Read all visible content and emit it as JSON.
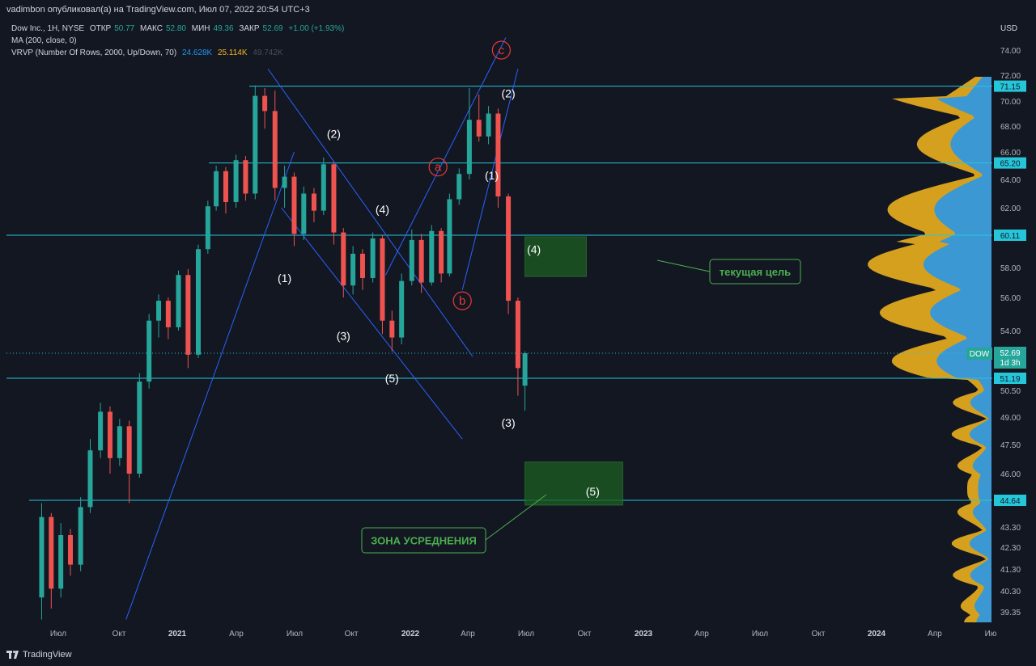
{
  "header": {
    "publisher": "vadimbon опубликовал(а) на TradingView.com, Июл 07, 2022 20:54 UTC+3"
  },
  "legend": {
    "symbol": "Dow Inc., 1H, NYSE",
    "open_label": "ОТКР",
    "open": "50.77",
    "high_label": "МАКС",
    "high": "52.80",
    "low_label": "МИН",
    "low": "49.36",
    "close_label": "ЗАКР",
    "close": "52.69",
    "change": "+1.00 (+1.93%)",
    "ma": "MA (200, close, 0)",
    "vrvp": "VRVP (Number Of Rows, 2000, Up/Down, 70)",
    "vrvp_up": "24.628K",
    "vrvp_down": "25.114K",
    "vrvp_total": "49.742K"
  },
  "footer": {
    "brand": "TradingView"
  },
  "colors": {
    "background": "#131722",
    "up": "#26a69a",
    "down": "#ef5350",
    "hline": "#26c6da",
    "channel": "#2962ff",
    "zone": "#1b5e20",
    "vp_up": "#2196f3",
    "vp_down": "#f9b81e",
    "label_red": "#e53935",
    "label_green": "#4caf50"
  },
  "chart_data": {
    "type": "candlestick",
    "symbol": "DOW",
    "currency": "USD",
    "x_ticks": [
      "Июл",
      "Окт",
      "2021",
      "Апр",
      "Июл",
      "Окт",
      "2022",
      "Апр",
      "Июл",
      "Окт",
      "2023",
      "Апр",
      "Июл",
      "Окт",
      "2024",
      "Апр",
      "Ию"
    ],
    "y_ticks": [
      "74.00",
      "72.00",
      "70.00",
      "68.00",
      "66.00",
      "64.00",
      "62.00",
      "58.00",
      "56.00",
      "54.00",
      "50.50",
      "49.00",
      "47.50",
      "46.00",
      "43.30",
      "42.30",
      "41.30",
      "40.30",
      "39.35"
    ],
    "horizontal_levels": [
      {
        "value": 71.15,
        "label": "71.15"
      },
      {
        "value": 65.2,
        "label": "65.20"
      },
      {
        "value": 60.11,
        "label": "60.11"
      },
      {
        "value": 51.19,
        "label": "51.19"
      },
      {
        "value": 44.64,
        "label": "44.64"
      }
    ],
    "current_price": {
      "symbol": "DOW",
      "price": "52.69",
      "countdown": "1d 3h"
    },
    "wave_labels": [
      {
        "text": "(1)",
        "date": "2021-06-20",
        "price": 57.3
      },
      {
        "text": "(2)",
        "date": "2021-09-05",
        "price": 67.4
      },
      {
        "text": "(3)",
        "date": "2021-09-20",
        "price": 53.7
      },
      {
        "text": "(4)",
        "date": "2021-11-20",
        "price": 61.9
      },
      {
        "text": "(5)",
        "date": "2021-12-05",
        "price": 51.2
      },
      {
        "text": "a",
        "date": "2022-02-15",
        "price": 64.9,
        "circled": true
      },
      {
        "text": "b",
        "date": "2022-03-25",
        "price": 55.8,
        "circled": true
      },
      {
        "text": "c",
        "date": "2022-05-25",
        "price": 74.0,
        "circled": true
      },
      {
        "text": "(1)",
        "date": "2022-05-10",
        "price": 64.3
      },
      {
        "text": "(2)",
        "date": "2022-06-05",
        "price": 70.6
      },
      {
        "text": "(3)",
        "date": "2022-06-05",
        "price": 48.7
      },
      {
        "text": "(4)",
        "date": "2022-07-15",
        "price": 59.2
      },
      {
        "text": "(5)",
        "date": "2022-10-15",
        "price": 45.1
      }
    ],
    "zones": [
      {
        "start": "2022-07-01",
        "end": "2022-10-05",
        "top": 60.0,
        "bottom": 57.4
      },
      {
        "start": "2022-07-01",
        "end": "2022-12-01",
        "top": 46.6,
        "bottom": 44.4
      }
    ],
    "callouts": [
      {
        "text": "текущая цель"
      },
      {
        "text": "ЗОНА УСРЕДНЕНИЯ"
      }
    ],
    "candles": [
      {
        "date": "2020-06-05",
        "o": 40.0,
        "h": 44.5,
        "l": 39.0,
        "c": 43.8
      },
      {
        "date": "2020-06-20",
        "o": 43.8,
        "h": 44.0,
        "l": 39.5,
        "c": 40.4
      },
      {
        "date": "2020-07-05",
        "o": 40.4,
        "h": 43.5,
        "l": 40.0,
        "c": 42.9
      },
      {
        "date": "2020-07-20",
        "o": 42.9,
        "h": 43.2,
        "l": 41.0,
        "c": 41.5
      },
      {
        "date": "2020-08-05",
        "o": 41.5,
        "h": 44.8,
        "l": 41.2,
        "c": 44.3
      },
      {
        "date": "2020-08-20",
        "o": 44.3,
        "h": 47.8,
        "l": 44.0,
        "c": 47.2
      },
      {
        "date": "2020-09-05",
        "o": 47.2,
        "h": 49.8,
        "l": 46.8,
        "c": 49.3
      },
      {
        "date": "2020-09-20",
        "o": 49.3,
        "h": 49.6,
        "l": 46.0,
        "c": 46.8
      },
      {
        "date": "2020-10-05",
        "o": 46.8,
        "h": 48.9,
        "l": 46.4,
        "c": 48.5
      },
      {
        "date": "2020-10-20",
        "o": 48.5,
        "h": 48.8,
        "l": 44.5,
        "c": 46.0
      },
      {
        "date": "2020-11-05",
        "o": 46.0,
        "h": 51.5,
        "l": 45.8,
        "c": 51.0
      },
      {
        "date": "2020-11-20",
        "o": 51.0,
        "h": 55.0,
        "l": 50.6,
        "c": 54.6
      },
      {
        "date": "2020-12-05",
        "o": 54.6,
        "h": 56.2,
        "l": 53.6,
        "c": 55.8
      },
      {
        "date": "2020-12-20",
        "o": 55.8,
        "h": 56.0,
        "l": 53.5,
        "c": 54.2
      },
      {
        "date": "2021-01-05",
        "o": 54.2,
        "h": 57.8,
        "l": 54.0,
        "c": 57.5
      },
      {
        "date": "2021-01-20",
        "o": 57.5,
        "h": 57.9,
        "l": 51.8,
        "c": 52.6
      },
      {
        "date": "2021-02-05",
        "o": 52.6,
        "h": 59.5,
        "l": 52.4,
        "c": 59.2
      },
      {
        "date": "2021-02-20",
        "o": 59.2,
        "h": 62.5,
        "l": 58.9,
        "c": 62.1
      },
      {
        "date": "2021-03-05",
        "o": 62.1,
        "h": 65.0,
        "l": 61.8,
        "c": 64.6
      },
      {
        "date": "2021-03-20",
        "o": 64.6,
        "h": 64.9,
        "l": 61.6,
        "c": 62.4
      },
      {
        "date": "2021-04-05",
        "o": 62.4,
        "h": 65.8,
        "l": 62.0,
        "c": 65.4
      },
      {
        "date": "2021-04-20",
        "o": 65.4,
        "h": 65.7,
        "l": 62.5,
        "c": 63.0
      },
      {
        "date": "2021-05-05",
        "o": 63.0,
        "h": 71.2,
        "l": 62.6,
        "c": 70.4
      },
      {
        "date": "2021-05-20",
        "o": 70.4,
        "h": 71.0,
        "l": 67.8,
        "c": 69.2
      },
      {
        "date": "2021-06-05",
        "o": 69.2,
        "h": 70.8,
        "l": 62.5,
        "c": 63.4
      },
      {
        "date": "2021-06-20",
        "o": 63.4,
        "h": 65.0,
        "l": 62.0,
        "c": 64.2
      },
      {
        "date": "2021-07-05",
        "o": 64.2,
        "h": 64.5,
        "l": 59.4,
        "c": 60.2
      },
      {
        "date": "2021-07-20",
        "o": 60.2,
        "h": 63.5,
        "l": 59.8,
        "c": 63.0
      },
      {
        "date": "2021-08-05",
        "o": 63.0,
        "h": 63.4,
        "l": 61.0,
        "c": 61.8
      },
      {
        "date": "2021-08-20",
        "o": 61.8,
        "h": 65.6,
        "l": 61.5,
        "c": 65.1
      },
      {
        "date": "2021-09-05",
        "o": 65.1,
        "h": 65.3,
        "l": 59.5,
        "c": 60.3
      },
      {
        "date": "2021-09-20",
        "o": 60.3,
        "h": 60.6,
        "l": 56.0,
        "c": 56.8
      },
      {
        "date": "2021-10-05",
        "o": 56.8,
        "h": 59.4,
        "l": 56.2,
        "c": 58.9
      },
      {
        "date": "2021-10-20",
        "o": 58.9,
        "h": 59.2,
        "l": 56.5,
        "c": 57.3
      },
      {
        "date": "2021-11-05",
        "o": 57.3,
        "h": 60.3,
        "l": 57.0,
        "c": 59.9
      },
      {
        "date": "2021-11-20",
        "o": 59.9,
        "h": 60.1,
        "l": 53.8,
        "c": 54.6
      },
      {
        "date": "2021-12-05",
        "o": 54.6,
        "h": 55.2,
        "l": 52.8,
        "c": 53.6
      },
      {
        "date": "2021-12-20",
        "o": 53.6,
        "h": 57.6,
        "l": 53.2,
        "c": 57.1
      },
      {
        "date": "2022-01-05",
        "o": 57.1,
        "h": 60.5,
        "l": 56.8,
        "c": 59.8
      },
      {
        "date": "2022-01-20",
        "o": 59.8,
        "h": 60.2,
        "l": 56.3,
        "c": 57.0
      },
      {
        "date": "2022-02-05",
        "o": 57.0,
        "h": 60.8,
        "l": 56.8,
        "c": 60.4
      },
      {
        "date": "2022-02-20",
        "o": 60.4,
        "h": 60.6,
        "l": 57.0,
        "c": 57.6
      },
      {
        "date": "2022-03-05",
        "o": 57.6,
        "h": 63.0,
        "l": 57.4,
        "c": 62.6
      },
      {
        "date": "2022-03-20",
        "o": 62.6,
        "h": 64.8,
        "l": 62.2,
        "c": 64.4
      },
      {
        "date": "2022-04-05",
        "o": 64.4,
        "h": 71.0,
        "l": 64.0,
        "c": 68.5
      },
      {
        "date": "2022-04-20",
        "o": 68.5,
        "h": 70.5,
        "l": 66.8,
        "c": 67.2
      },
      {
        "date": "2022-05-05",
        "o": 67.2,
        "h": 69.6,
        "l": 66.6,
        "c": 69.0
      },
      {
        "date": "2022-05-20",
        "o": 69.0,
        "h": 69.4,
        "l": 62.0,
        "c": 62.8
      },
      {
        "date": "2022-06-05",
        "o": 62.8,
        "h": 63.0,
        "l": 55.0,
        "c": 55.8
      },
      {
        "date": "2022-06-20",
        "o": 55.8,
        "h": 56.0,
        "l": 50.2,
        "c": 51.8
      },
      {
        "date": "2022-07-01",
        "o": 50.77,
        "h": 52.8,
        "l": 49.36,
        "c": 52.69
      }
    ]
  }
}
